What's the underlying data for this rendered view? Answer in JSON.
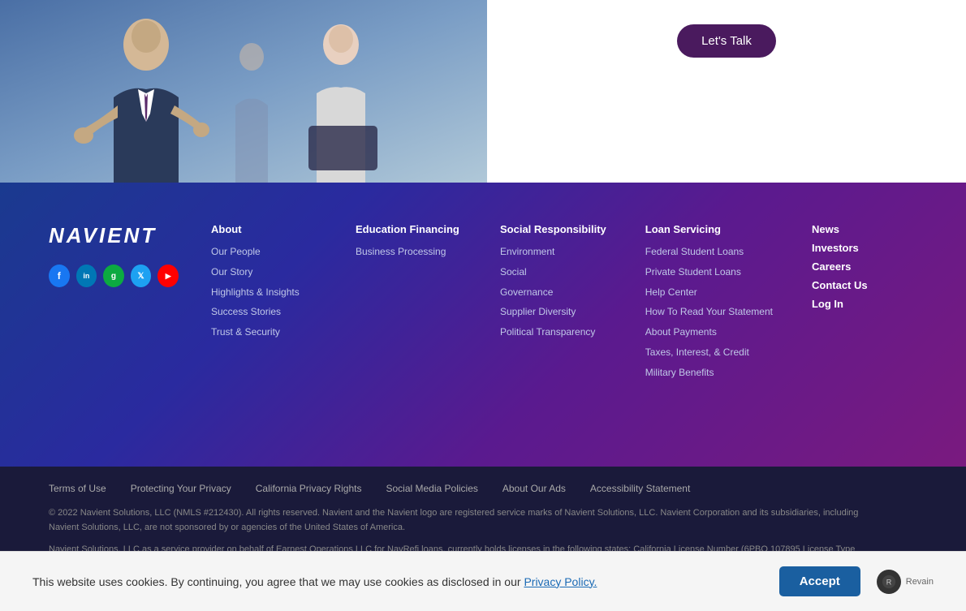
{
  "hero": {
    "lets_talk_label": "Let's Talk"
  },
  "footer": {
    "logo_text": "NAVIENT",
    "social": [
      {
        "name": "Facebook",
        "icon": "f",
        "class": "facebook"
      },
      {
        "name": "LinkedIn",
        "icon": "in",
        "class": "linkedin"
      },
      {
        "name": "Glassdoor",
        "icon": "g",
        "class": "glassdoor"
      },
      {
        "name": "Twitter",
        "icon": "t",
        "class": "twitter"
      },
      {
        "name": "YouTube",
        "icon": "▶",
        "class": "youtube"
      }
    ],
    "columns": [
      {
        "header": "About",
        "links": [
          "Our People",
          "Our Story",
          "Highlights & Insights",
          "Success Stories",
          "Trust & Security"
        ]
      },
      {
        "header": "Education Financing",
        "links": [
          "Business Processing"
        ]
      },
      {
        "header": "Social Responsibility",
        "links": [
          "Environment",
          "Social",
          "Governance",
          "Supplier Diversity",
          "Political Transparency"
        ]
      },
      {
        "header": "Loan Servicing",
        "links": [
          "Federal Student Loans",
          "Private Student Loans",
          "Help Center",
          "How To Read Your Statement",
          "About Payments",
          "Taxes, Interest, & Credit",
          "Military Benefits"
        ]
      },
      {
        "header_links": [
          "News",
          "Investors",
          "Careers",
          "Contact Us",
          "Log In"
        ]
      }
    ]
  },
  "bottom_bar": {
    "links": [
      "Terms of Use",
      "Protecting Your Privacy",
      "California Privacy Rights",
      "Social Media Policies",
      "About Our Ads",
      "Accessibility Statement"
    ],
    "copyright": "© 2022 Navient Solutions, LLC (NMLS #212430). All rights reserved. Navient and the Navient logo are registered service marks of Navient Solutions, LLC. Navient Corporation and its subsidiaries, including Navient Solutions, LLC, are not sponsored by or agencies of the United States of America.",
    "extra": "Navient Solutions, LLC as a service provider on behalf of Earnest Operations LLC for NavRefi loans, currently holds licenses in the following states: California License Number (6PBO 107895 License Type Finance Lender..."
  },
  "cookie_banner": {
    "text": "This website uses cookies. By continuing, you agree that we may use cookies as disclosed in our",
    "link_text": "Privacy Policy.",
    "accept_label": "Accept",
    "revain_label": "Revain"
  }
}
